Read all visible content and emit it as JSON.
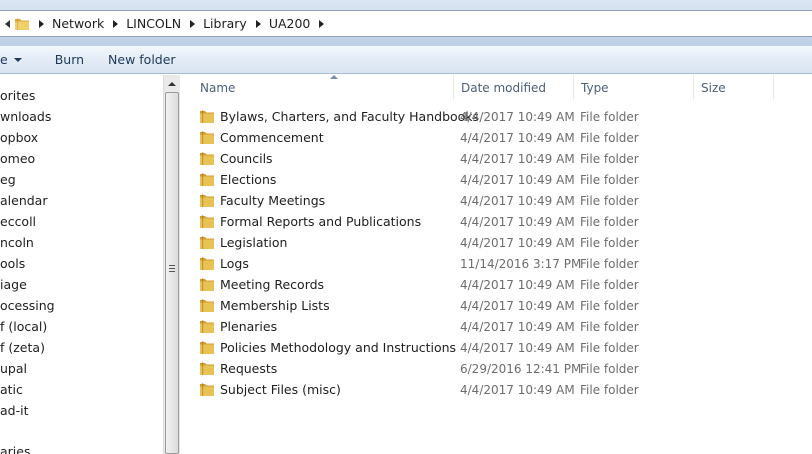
{
  "address": {
    "crumbs": [
      "Network",
      "LINCOLN",
      "Library",
      "UA200"
    ]
  },
  "toolbar": {
    "organize_label": "e",
    "burn_label": "Burn",
    "new_folder_label": "New folder"
  },
  "nav": {
    "items": [
      "orites",
      "wnloads",
      "opbox",
      "omeo",
      "eg",
      "alendar",
      "eccoll",
      "ncoln",
      "ools",
      "iage",
      "ocessing",
      "f (local)",
      "f (zeta)",
      "upal",
      "atic",
      "ad-it",
      "",
      "aries"
    ]
  },
  "columns": {
    "name": "Name",
    "date": "Date modified",
    "type": "Type",
    "size": "Size"
  },
  "files": [
    {
      "name": "Bylaws, Charters, and Faculty Handbooks",
      "date": "4/4/2017 10:49 AM",
      "type": "File folder"
    },
    {
      "name": "Commencement",
      "date": "4/4/2017 10:49 AM",
      "type": "File folder"
    },
    {
      "name": "Councils",
      "date": "4/4/2017 10:49 AM",
      "type": "File folder"
    },
    {
      "name": "Elections",
      "date": "4/4/2017 10:49 AM",
      "type": "File folder"
    },
    {
      "name": "Faculty Meetings",
      "date": "4/4/2017 10:49 AM",
      "type": "File folder"
    },
    {
      "name": "Formal Reports and Publications",
      "date": "4/4/2017 10:49 AM",
      "type": "File folder"
    },
    {
      "name": "Legislation",
      "date": "4/4/2017 10:49 AM",
      "type": "File folder"
    },
    {
      "name": "Logs",
      "date": "11/14/2016 3:17 PM",
      "type": "File folder"
    },
    {
      "name": "Meeting Records",
      "date": "4/4/2017 10:49 AM",
      "type": "File folder"
    },
    {
      "name": "Membership Lists",
      "date": "4/4/2017 10:49 AM",
      "type": "File folder"
    },
    {
      "name": "Plenaries",
      "date": "4/4/2017 10:49 AM",
      "type": "File folder"
    },
    {
      "name": "Policies Methodology and Instructions",
      "date": "4/4/2017 10:49 AM",
      "type": "File folder"
    },
    {
      "name": "Requests",
      "date": "6/29/2016 12:41 PM",
      "type": "File folder"
    },
    {
      "name": "Subject Files (misc)",
      "date": "4/4/2017 10:49 AM",
      "type": "File folder"
    }
  ],
  "colors": {
    "folder": "#e9c255",
    "toolbar_text": "#1e395b",
    "header_text": "#4c607a",
    "secondary_text": "#6d6d6d"
  }
}
